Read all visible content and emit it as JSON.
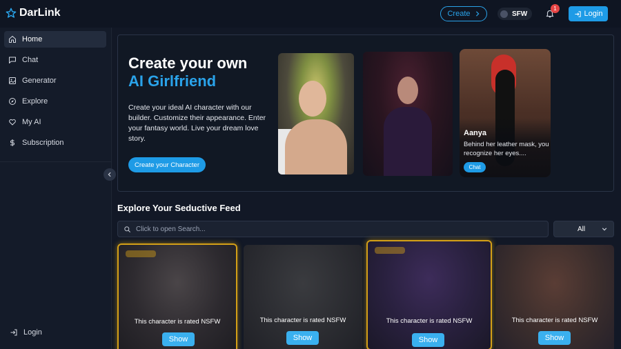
{
  "header": {
    "logo_text": "DarLink",
    "create_label": "Create",
    "sfw_label": "SFW",
    "notification_count": "1",
    "login_label": "Login"
  },
  "sidebar": {
    "items": [
      {
        "label": "Home",
        "icon": "home-icon",
        "active": true
      },
      {
        "label": "Chat",
        "icon": "chat-icon"
      },
      {
        "label": "Generator",
        "icon": "image-icon"
      },
      {
        "label": "Explore",
        "icon": "compass-icon"
      },
      {
        "label": "My AI",
        "icon": "heart-icon"
      },
      {
        "label": "Subscription",
        "icon": "dollar-icon"
      }
    ],
    "login_label": "Login"
  },
  "hero": {
    "title_line1": "Create your own",
    "title_line2": "AI Girlfriend",
    "description": "Create your ideal AI character with our builder. Customize their appearance. Enter your fantasy world. Live your dream love story.",
    "cta_label": "Create your Character",
    "featured": {
      "name": "Aanya",
      "description": "Behind her leather mask, you recognize her eyes....",
      "chat_label": "Chat"
    }
  },
  "feed": {
    "title": "Explore Your Seductive Feed",
    "search_placeholder": "Click to open Search...",
    "filter_value": "All",
    "cards": [
      {
        "rating_text": "This character is rated NSFW",
        "show_label": "Show",
        "highlighted": true
      },
      {
        "rating_text": "This character is rated NSFW",
        "show_label": "Show",
        "highlighted": false
      },
      {
        "rating_text": "This character is rated NSFW",
        "show_label": "Show",
        "highlighted": true
      },
      {
        "rating_text": "This character is rated NSFW",
        "show_label": "Show",
        "highlighted": false
      }
    ]
  },
  "colors": {
    "accent": "#1e9be6",
    "background": "#121826",
    "highlight_gold": "#d4a017"
  }
}
